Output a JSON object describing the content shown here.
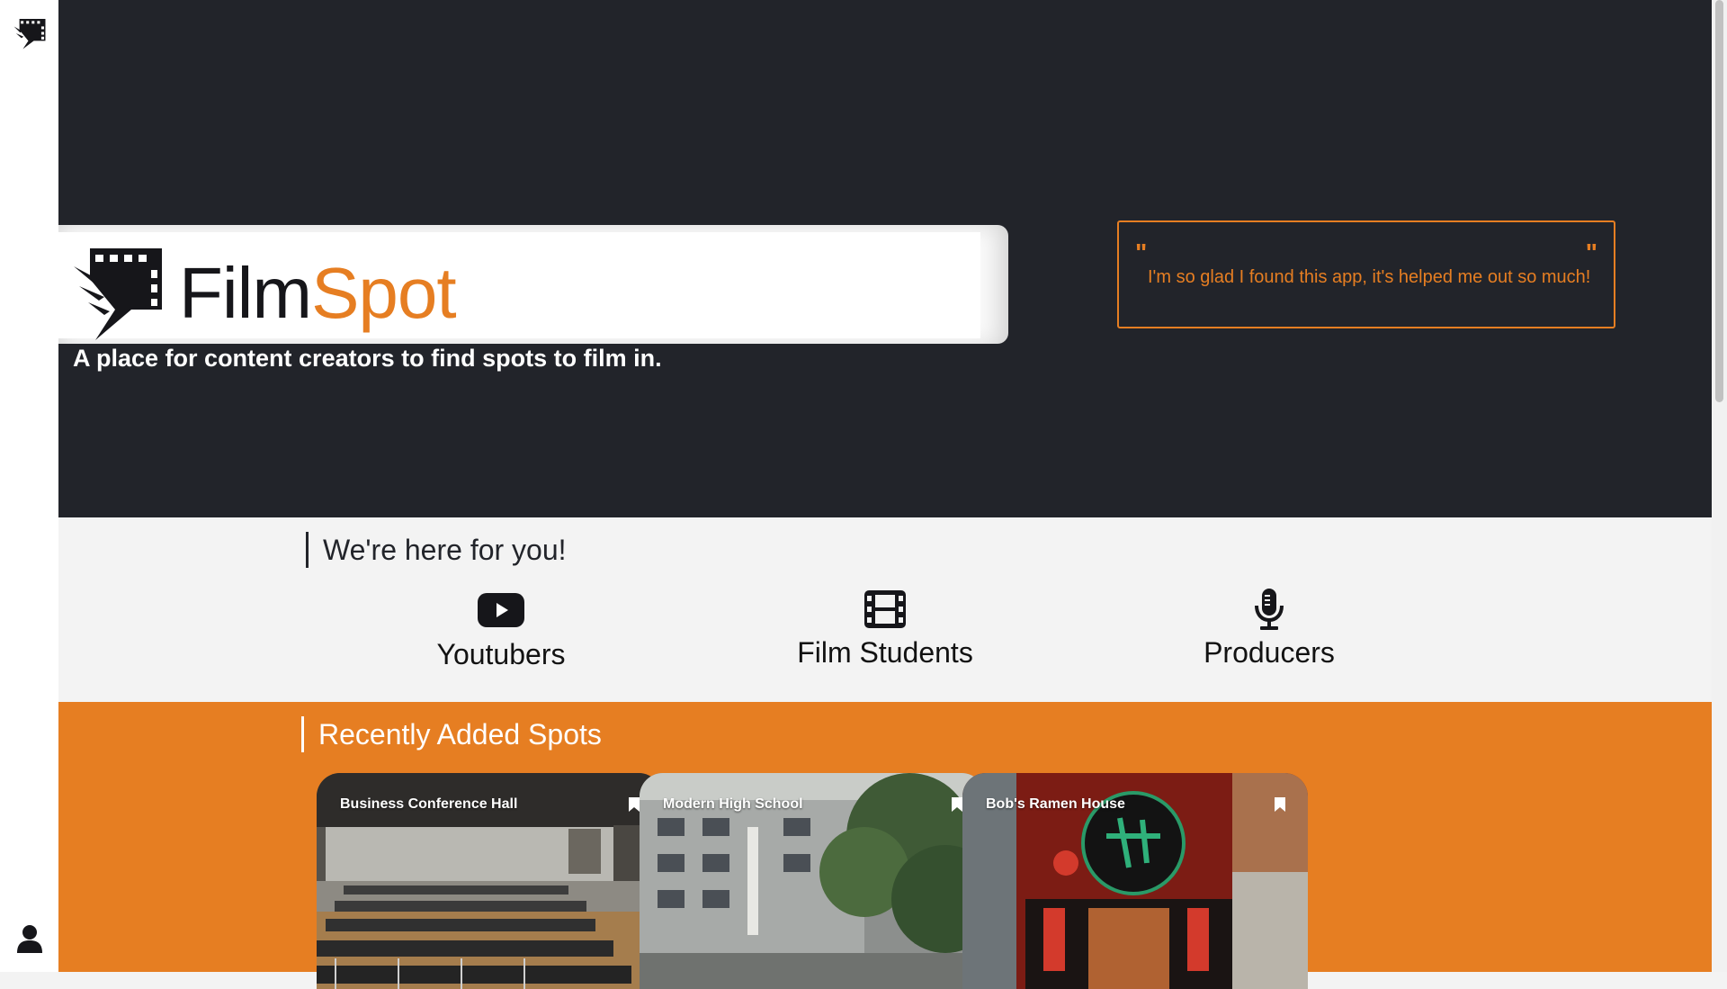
{
  "brand": {
    "word_part1": "Film",
    "word_part2": "Spot",
    "tagline_part1": "A place for ",
    "tagline_bold": "content creators",
    "tagline_part2": " to find spots to film in."
  },
  "testimonial": {
    "open_mark": "\"",
    "text": "I'm so glad I found this app, it's helped me out so much!",
    "close_mark": "\""
  },
  "audience": {
    "title": "We're here for you!",
    "items": [
      {
        "label": "Youtubers",
        "icon": "youtube-icon"
      },
      {
        "label": "Film Students",
        "icon": "film-icon"
      },
      {
        "label": "Producers",
        "icon": "microphone-icon"
      }
    ]
  },
  "spots": {
    "title": "Recently Added Spots",
    "cards": [
      {
        "title": "Business Conference Hall",
        "icon": "bookmark-icon"
      },
      {
        "title": "Modern High School",
        "icon": "bookmark-icon"
      },
      {
        "title": "Bob's Ramen House",
        "icon": "bookmark-icon"
      }
    ]
  },
  "rail": {
    "logo_icon": "filmspot-logo-icon",
    "user_icon": "user-icon"
  },
  "colors": {
    "accent": "#e67e22",
    "hero_bg": "#22242a",
    "light_bg": "#f3f3f3",
    "text_dark": "#121212"
  }
}
